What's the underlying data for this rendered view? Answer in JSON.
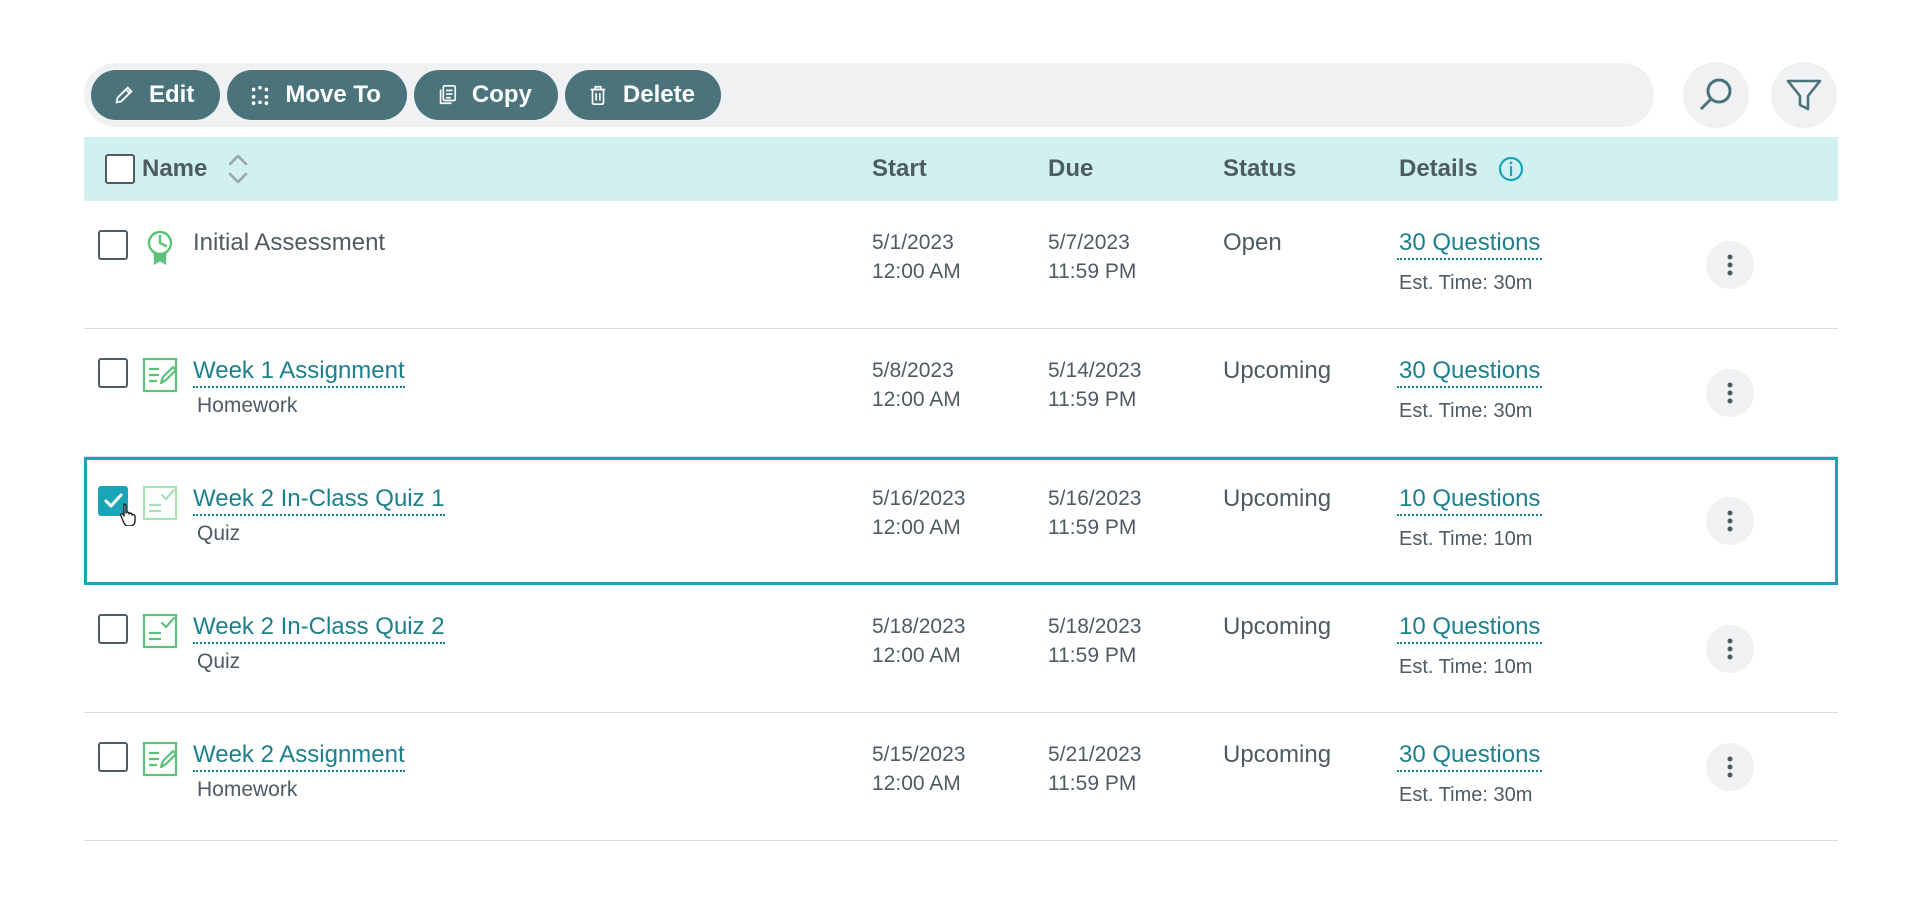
{
  "toolbar": {
    "edit_label": "Edit",
    "move_label": "Move To",
    "copy_label": "Copy",
    "delete_label": "Delete"
  },
  "table": {
    "headers": {
      "name": "Name",
      "start": "Start",
      "due": "Due",
      "status": "Status",
      "details": "Details"
    },
    "rows": [
      {
        "name": "Initial Assessment",
        "type": "",
        "icon": "assessment-icon",
        "start_date": "5/1/2023",
        "start_time": "12:00 AM",
        "due_date": "5/7/2023",
        "due_time": "11:59 PM",
        "status": "Open",
        "questions": "30 Questions",
        "est_time": "Est. Time: 30m",
        "checked": false
      },
      {
        "name": "Week 1 Assignment",
        "type": "Homework",
        "icon": "homework-icon",
        "start_date": "5/8/2023",
        "start_time": "12:00 AM",
        "due_date": "5/14/2023",
        "due_time": "11:59 PM",
        "status": "Upcoming",
        "questions": "30 Questions",
        "est_time": "Est. Time: 30m",
        "checked": false
      },
      {
        "name": "Week 2 In-Class Quiz 1",
        "type": "Quiz",
        "icon": "quiz-icon",
        "start_date": "5/16/2023",
        "start_time": "12:00 AM",
        "due_date": "5/16/2023",
        "due_time": "11:59 PM",
        "status": "Upcoming",
        "questions": "10 Questions",
        "est_time": "Est. Time: 10m",
        "checked": true
      },
      {
        "name": "Week 2 In-Class Quiz 2",
        "type": "Quiz",
        "icon": "quiz-icon",
        "start_date": "5/18/2023",
        "start_time": "12:00 AM",
        "due_date": "5/18/2023",
        "due_time": "11:59 PM",
        "status": "Upcoming",
        "questions": "10 Questions",
        "est_time": "Est. Time: 10m",
        "checked": false
      },
      {
        "name": "Week 2 Assignment",
        "type": "Homework",
        "icon": "homework-icon",
        "start_date": "5/15/2023",
        "start_time": "12:00 AM",
        "due_date": "5/21/2023",
        "due_time": "11:59 PM",
        "status": "Upcoming",
        "questions": "30 Questions",
        "est_time": "Est. Time: 30m",
        "checked": false
      }
    ]
  },
  "colors": {
    "toolbar_button": "#4a737c",
    "header_bg": "#d0f0f2",
    "accent": "#1aa4b8",
    "link": "#1e7f8c",
    "icon_green": "#5cc27a"
  }
}
